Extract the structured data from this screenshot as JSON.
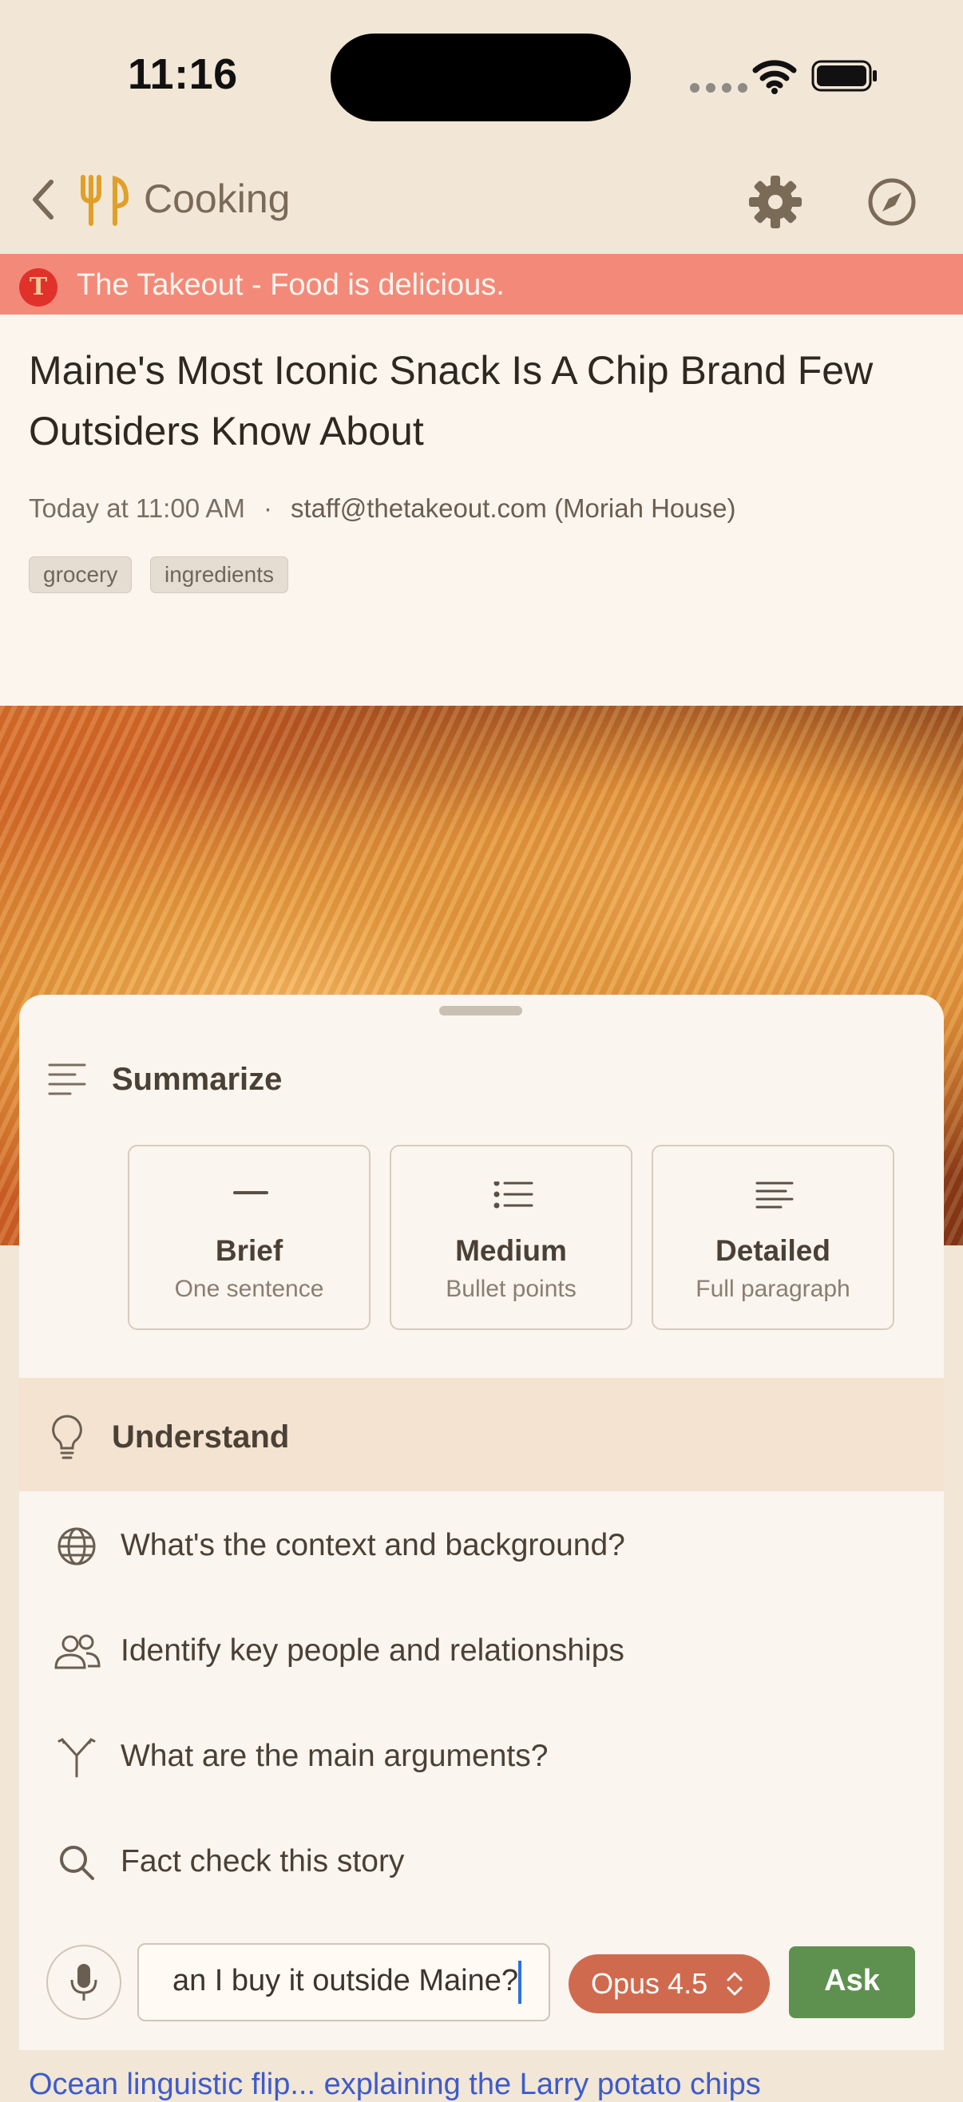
{
  "status_bar": {
    "time": "11:16"
  },
  "nav": {
    "back_label": "",
    "title": "Cooking"
  },
  "source": {
    "badge": "T",
    "name": "The Takeout - Food is delicious."
  },
  "article": {
    "title": "Maine's Most Iconic Snack Is A Chip Brand Few Outsiders Know About",
    "date": "Today at 11:00 AM",
    "separator": "·",
    "author": "staff@thetakeout.com (Moriah House)",
    "tags": [
      "grocery",
      "ingredients"
    ]
  },
  "summarize": {
    "title": "Summarize",
    "options": [
      {
        "title": "Brief",
        "subtitle": "One sentence",
        "icon": "dash-icon"
      },
      {
        "title": "Medium",
        "subtitle": "Bullet points",
        "icon": "list-icon"
      },
      {
        "title": "Detailed",
        "subtitle": "Full paragraph",
        "icon": "paragraph-icon"
      }
    ]
  },
  "understand": {
    "title": "Understand",
    "items": [
      {
        "label": "What's the context and background?",
        "icon": "globe-icon"
      },
      {
        "label": "Identify key people and relationships",
        "icon": "people-icon"
      },
      {
        "label": "What are the main arguments?",
        "icon": "fork-icon"
      },
      {
        "label": "Fact check this story",
        "icon": "search-icon"
      }
    ]
  },
  "ask_bar": {
    "input_value": "an I buy it outside Maine?",
    "model": "Opus 4.5",
    "ask_label": "Ask"
  },
  "footer": {
    "link_text": "Ocean linguistic flip... explaining the Larry potato chips"
  },
  "colors": {
    "banner": "#f38a79",
    "accent": "#d06a4e",
    "ask": "#5e9150"
  }
}
